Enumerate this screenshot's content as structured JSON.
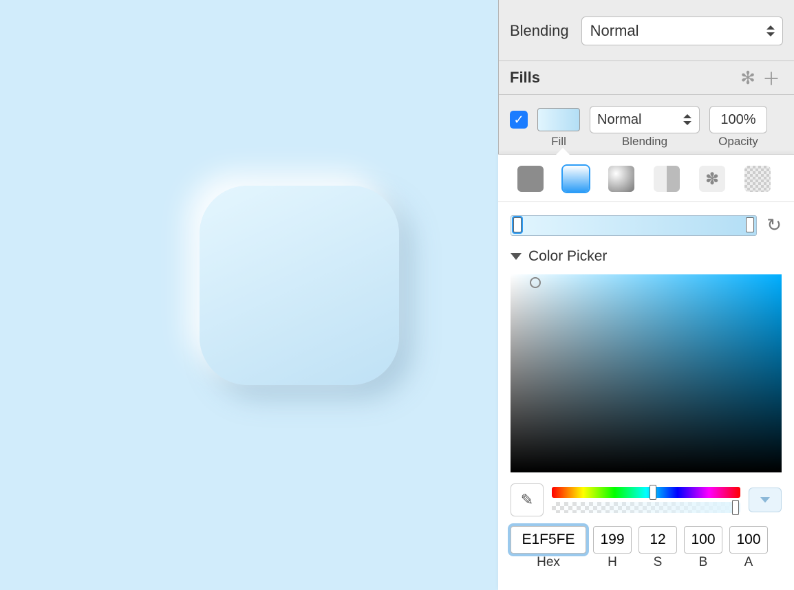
{
  "blending_row": {
    "label": "Blending",
    "value": "Normal"
  },
  "fills_section": {
    "title": "Fills",
    "checked": true,
    "blend_value": "Normal",
    "opacity_value": "100%",
    "sublabel_fill": "Fill",
    "sublabel_blend": "Blending",
    "sublabel_opacity": "Opacity"
  },
  "fill_types": {
    "flat_name": "solid-color",
    "linear_name": "linear-gradient",
    "radial_name": "radial-gradient",
    "angular_name": "angular-gradient",
    "image_name": "image-fill",
    "noise_name": "noise-fill"
  },
  "color_picker": {
    "title": "Color Picker",
    "hex": "E1F5FE",
    "h": "199",
    "s": "12",
    "b": "100",
    "a": "100",
    "label_hex": "Hex",
    "label_h": "H",
    "label_s": "S",
    "label_b": "B",
    "label_a": "A"
  },
  "colors": {
    "canvas_bg": "#D1ECFB",
    "shape_light": "#E4F6FE",
    "shape_dark": "#BFE1F5",
    "picked": "#E1F5FE"
  }
}
